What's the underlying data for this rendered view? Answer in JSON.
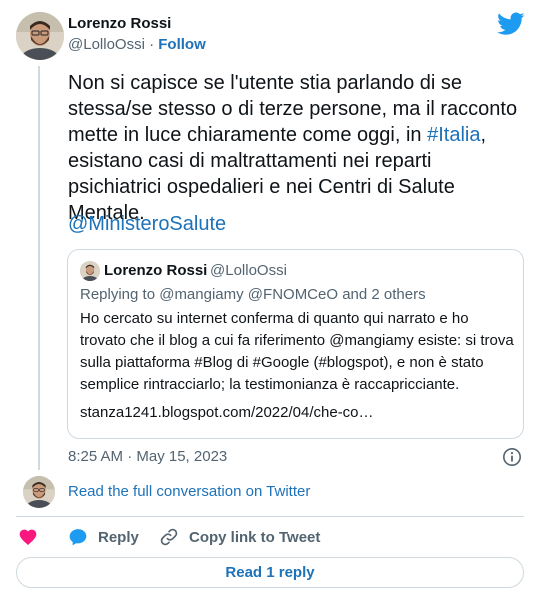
{
  "author": {
    "name": "Lorenzo Rossi",
    "handle": "@LolloOssi",
    "separator": "·",
    "follow_label": "Follow"
  },
  "tweet": {
    "text_before_link": "Non si capisce se l'utente stia parlando di se stessa/se stesso o di terze persone, ma il racconto mette in luce chiaramente come oggi, in ",
    "hashtag": "#Italia",
    "text_after_link": ", esistano casi di maltrattamenti nei reparti psichiatrici ospedalieri e nei Centri di Salute Mentale.",
    "mention": "@MinisteroSalute"
  },
  "quoted_tweet": {
    "name": "Lorenzo Rossi",
    "handle": "@LolloOssi",
    "replying_to": "Replying to @mangiamy @FNOMCeO and 2 others",
    "text": "Ho cercato su internet conferma di quanto qui narrato e ho trovato che il blog a cui fa riferimento @mangiamy esiste: si trova sulla piattaforma #Blog di #Google (#blogspot), e non è stato semplice rintracciarlo; la testimonianza è raccapricciante.",
    "link": "stanza1241.blogspot.com/2022/04/che-co…"
  },
  "timestamp": "8:25 AM · May 15, 2023",
  "read_conversation": "Read the full conversation on Twitter",
  "actions": {
    "reply_label": "Reply",
    "copy_label": "Copy link to Tweet"
  },
  "read_reply_label": "Read 1 reply",
  "colors": {
    "link": "#1d72b8",
    "like": "#f91880",
    "reply_icon": "#1d9bf0",
    "secondary_text": "#536471",
    "border": "#cfd9de",
    "twitter_blue": "#1d9bf0"
  },
  "icons": [
    "twitter-bird-icon",
    "info-icon",
    "heart-icon",
    "reply-bubble-icon",
    "link-icon"
  ]
}
